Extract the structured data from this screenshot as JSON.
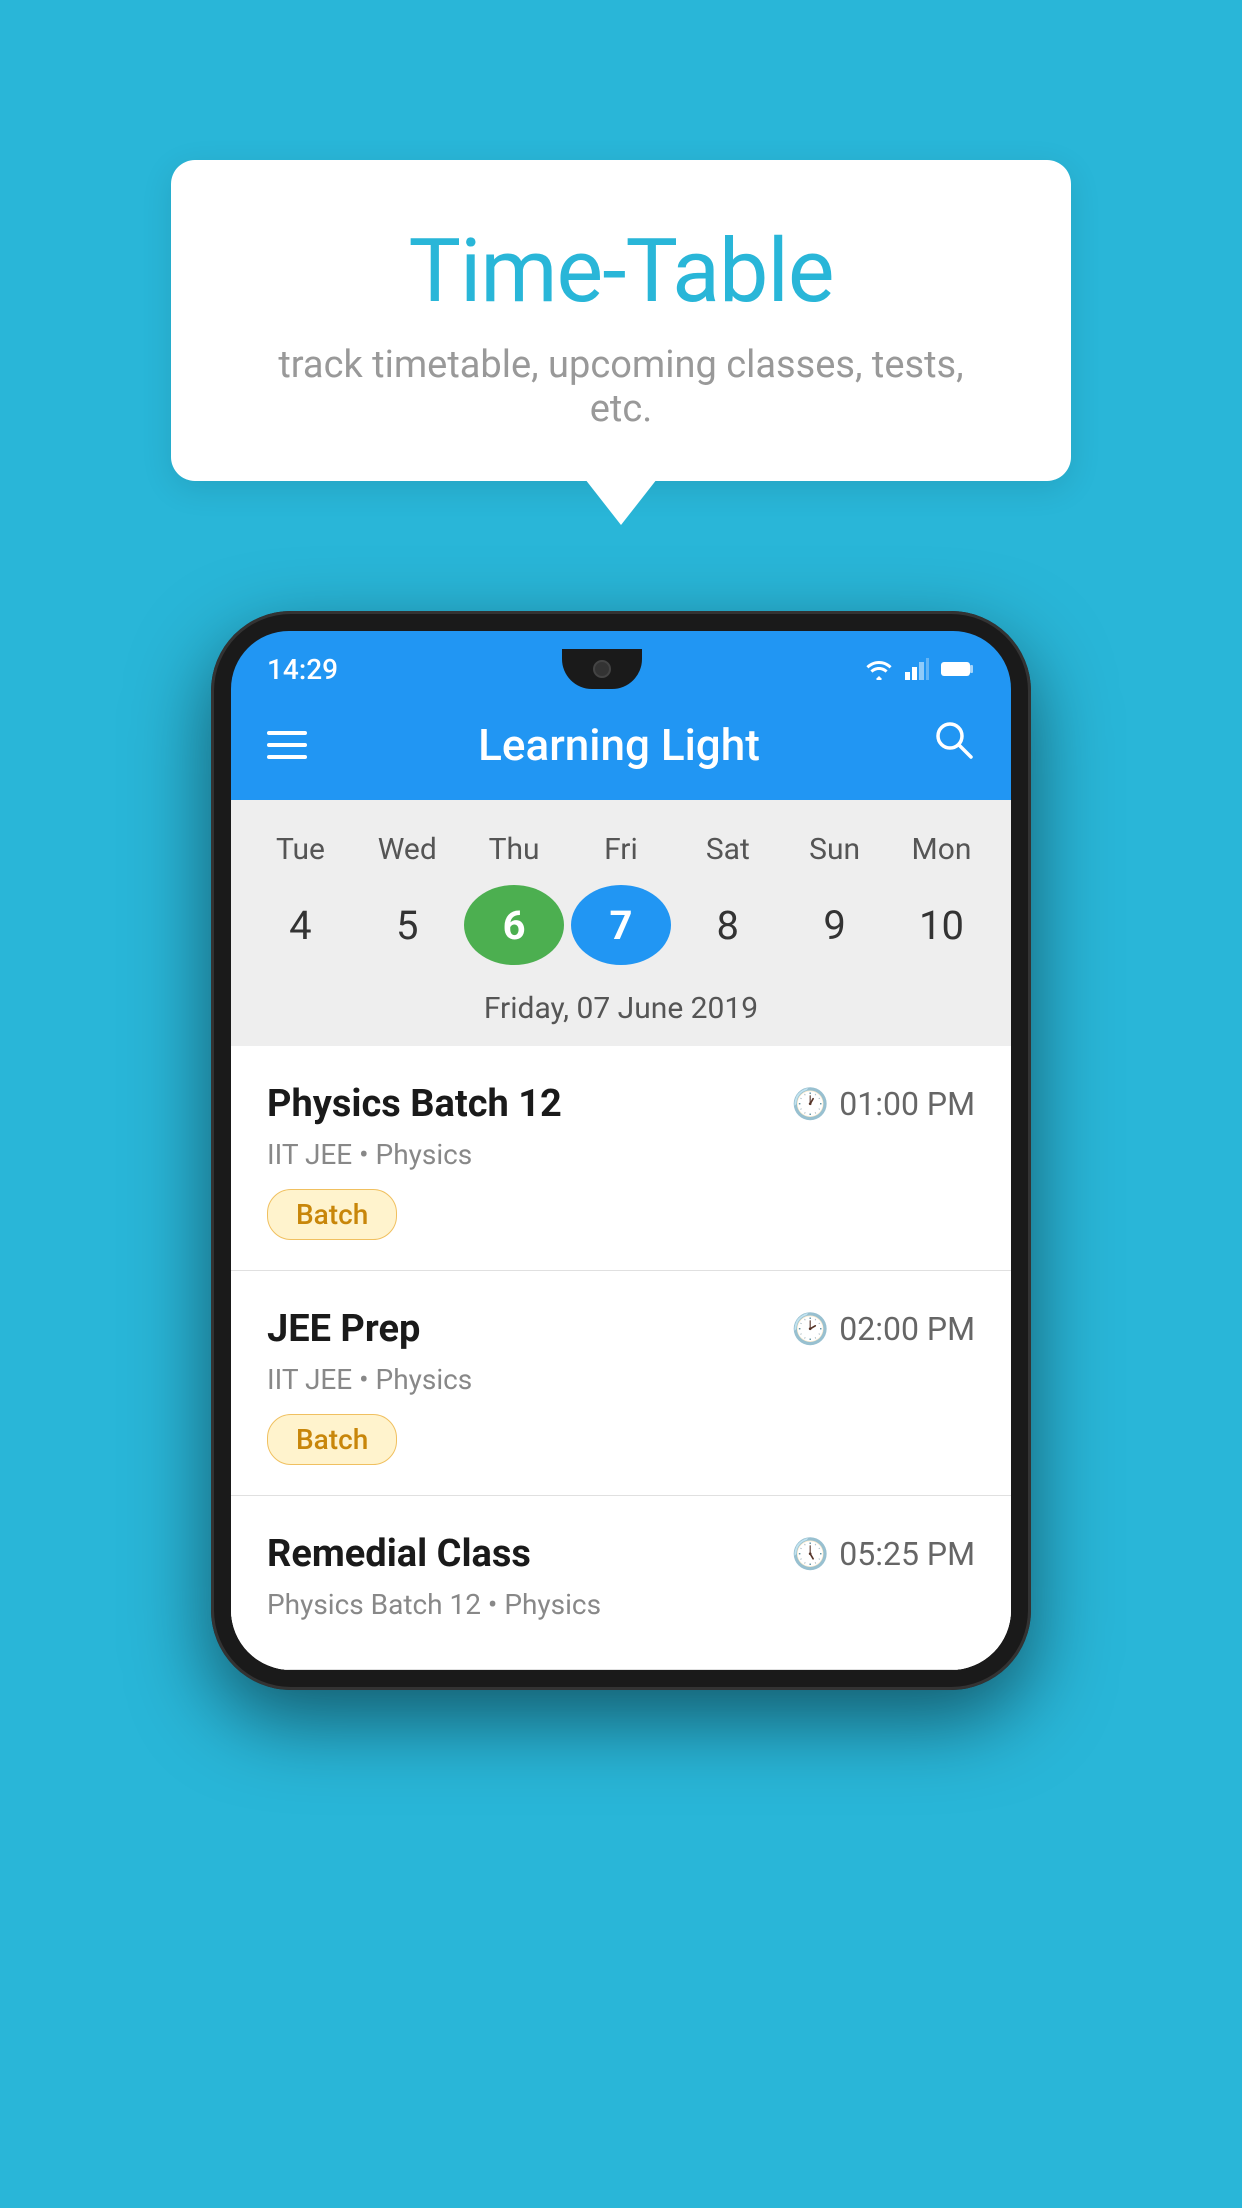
{
  "background_color": "#29B6D8",
  "speech_bubble": {
    "title": "Time-Table",
    "subtitle": "track timetable, upcoming classes, tests, etc."
  },
  "phone": {
    "status_bar": {
      "time": "14:29"
    },
    "app_bar": {
      "title": "Learning Light",
      "menu_icon": "hamburger-icon",
      "search_icon": "search-icon"
    },
    "calendar": {
      "day_names": [
        "Tue",
        "Wed",
        "Thu",
        "Fri",
        "Sat",
        "Sun",
        "Mon"
      ],
      "day_numbers": [
        {
          "num": "4",
          "state": "normal"
        },
        {
          "num": "5",
          "state": "normal"
        },
        {
          "num": "6",
          "state": "today"
        },
        {
          "num": "7",
          "state": "selected"
        },
        {
          "num": "8",
          "state": "normal"
        },
        {
          "num": "9",
          "state": "normal"
        },
        {
          "num": "10",
          "state": "normal"
        }
      ],
      "selected_date_label": "Friday, 07 June 2019"
    },
    "classes": [
      {
        "title": "Physics Batch 12",
        "time": "01:00 PM",
        "subtitle": "IIT JEE • Physics",
        "badge": "Batch"
      },
      {
        "title": "JEE Prep",
        "time": "02:00 PM",
        "subtitle": "IIT JEE • Physics",
        "badge": "Batch"
      },
      {
        "title": "Remedial Class",
        "time": "05:25 PM",
        "subtitle": "Physics Batch 12 • Physics",
        "badge": ""
      }
    ]
  }
}
